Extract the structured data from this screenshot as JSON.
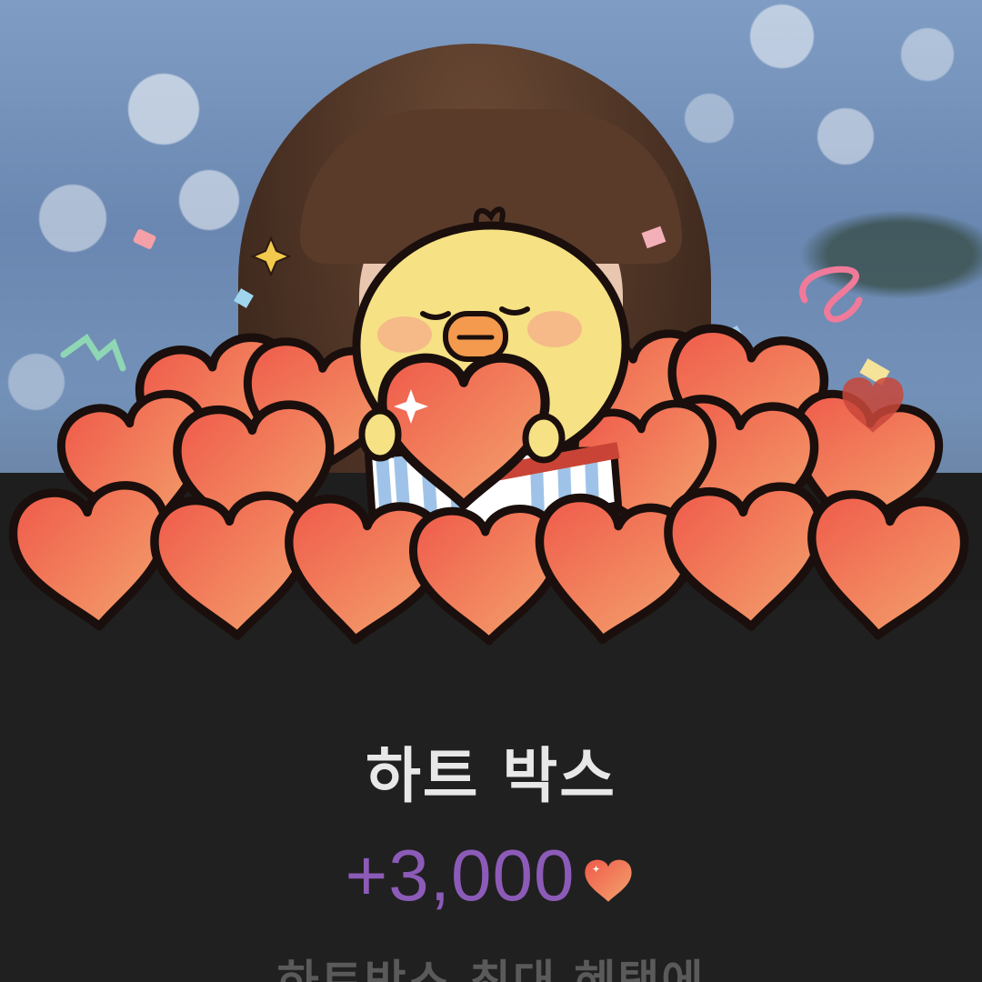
{
  "reward": {
    "title": "하트 박스",
    "amount": "+3,000",
    "subtitle": "하트박스 최대 혜택에"
  },
  "icons": {
    "amount_icon": "heart-icon",
    "sticker": "chick-holding-heart-sticker"
  },
  "colors": {
    "heart": "#f07a5a",
    "amount_text": "#8c5bb8",
    "panel": "#202020"
  }
}
